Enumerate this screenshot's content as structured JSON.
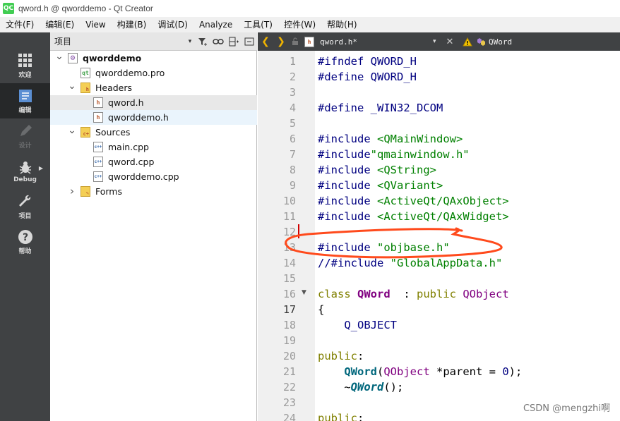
{
  "window": {
    "title": "qword.h @ qworddemo - Qt Creator",
    "app_icon_text": "QC"
  },
  "menu": [
    "文件(F)",
    "编辑(E)",
    "View",
    "构建(B)",
    "调试(D)",
    "Analyze",
    "工具(T)",
    "控件(W)",
    "帮助(H)"
  ],
  "modes": [
    {
      "label": "欢迎",
      "icon": "grid-icon",
      "state": "normal"
    },
    {
      "label": "编辑",
      "icon": "edit-document-icon",
      "state": "active"
    },
    {
      "label": "设计",
      "icon": "pencil-icon",
      "state": "disabled"
    },
    {
      "label": "Debug",
      "icon": "bug-icon",
      "state": "normal"
    },
    {
      "label": "项目",
      "icon": "wrench-icon",
      "state": "normal"
    },
    {
      "label": "帮助",
      "icon": "help-icon",
      "state": "normal"
    }
  ],
  "project_pane": {
    "title": "项目",
    "tools": [
      "filter-icon",
      "link-icon",
      "split-icon",
      "close-pane-icon"
    ]
  },
  "tree": [
    {
      "label": "qworddemo",
      "icon": "project-icon",
      "expanded": true,
      "bold": true
    },
    {
      "label": "qworddemo.pro",
      "icon": "pro-file-icon"
    },
    {
      "label": "Headers",
      "icon": "folder-h-icon",
      "expanded": true
    },
    {
      "label": "qword.h",
      "icon": "h-file-icon",
      "selected": true
    },
    {
      "label": "qworddemo.h",
      "icon": "h-file-icon"
    },
    {
      "label": "Sources",
      "icon": "folder-cpp-icon",
      "expanded": true
    },
    {
      "label": "main.cpp",
      "icon": "cpp-file-icon"
    },
    {
      "label": "qword.cpp",
      "icon": "cpp-file-icon"
    },
    {
      "label": "qworddemo.cpp",
      "icon": "cpp-file-icon"
    },
    {
      "label": "Forms",
      "icon": "folder-forms-icon",
      "expanded": false
    }
  ],
  "editor": {
    "file_name": "qword.h*",
    "symbol": "QWord",
    "file_icon_letter": "h",
    "current_line": "17"
  },
  "line_numbers": [
    "1",
    "2",
    "3",
    "4",
    "5",
    "6",
    "7",
    "8",
    "9",
    "10",
    "11",
    "12",
    "13",
    "14",
    "15",
    "16",
    "17",
    "18",
    "19",
    "20",
    "21",
    "22",
    "23",
    "24"
  ],
  "code_lines": [
    [
      [
        "kw-pp",
        "#ifndef QWORD_H"
      ]
    ],
    [
      [
        "kw-pp",
        "#define QWORD_H"
      ]
    ],
    [],
    [
      [
        "kw-pp",
        "#define _WIN32_DCOM"
      ]
    ],
    [],
    [
      [
        "kw-pp",
        "#include "
      ],
      [
        "str",
        "<QMainWindow>"
      ]
    ],
    [
      [
        "kw-pp",
        "#include"
      ],
      [
        "str",
        "\"qmainwindow.h\""
      ]
    ],
    [
      [
        "kw-pp",
        "#include "
      ],
      [
        "str",
        "<QString>"
      ]
    ],
    [
      [
        "kw-pp",
        "#include "
      ],
      [
        "str",
        "<QVariant>"
      ]
    ],
    [
      [
        "kw-pp",
        "#include "
      ],
      [
        "str",
        "<ActiveQt/QAxObject>"
      ]
    ],
    [
      [
        "kw-pp",
        "#include "
      ],
      [
        "str",
        "<ActiveQt/QAxWidget>"
      ]
    ],
    [],
    [
      [
        "kw-pp",
        "#include "
      ],
      [
        "str",
        "\"objbase.h\""
      ]
    ],
    [
      [
        "kw-pp",
        "//#include "
      ],
      [
        "str",
        "\"GlobalAppData.h\""
      ]
    ],
    [],
    [
      [
        "kw",
        "class "
      ],
      [
        "cls",
        "QWord"
      ],
      [
        "",
        "  : "
      ],
      [
        "kw",
        "public "
      ],
      [
        "type",
        "QObject"
      ]
    ],
    [
      [
        "",
        "{"
      ]
    ],
    [
      [
        "",
        "    "
      ],
      [
        "macro",
        "Q_OBJECT"
      ]
    ],
    [],
    [
      [
        "kw",
        "public"
      ],
      [
        "",
        ":"
      ]
    ],
    [
      [
        "",
        "    "
      ],
      [
        "fn",
        "QWord"
      ],
      [
        "",
        "("
      ],
      [
        "type",
        "QObject"
      ],
      [
        "",
        " *parent = "
      ],
      [
        "num",
        "0"
      ],
      [
        "",
        ");"
      ]
    ],
    [
      [
        "",
        "    ~"
      ],
      [
        "fni",
        "QWord"
      ],
      [
        "",
        "();"
      ]
    ],
    [],
    [
      [
        "kw",
        "public"
      ],
      [
        "",
        ":"
      ]
    ]
  ],
  "watermark": "CSDN @mengzhi啊",
  "colors": {
    "annotation": "#ff4a1c",
    "cursor": "#d00000",
    "sidebar": "#404244",
    "sidebar_active": "#262829"
  }
}
